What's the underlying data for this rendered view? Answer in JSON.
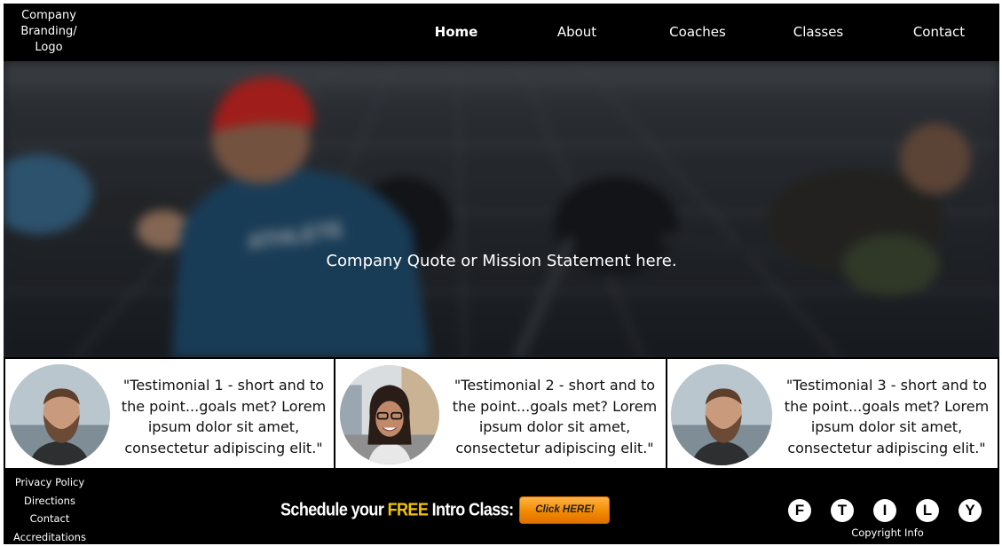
{
  "header": {
    "logo": "Company\nBranding/\nLogo",
    "nav": [
      {
        "label": "Home",
        "active": true
      },
      {
        "label": "About"
      },
      {
        "label": "Coaches"
      },
      {
        "label": "Classes"
      },
      {
        "label": "Contact"
      }
    ]
  },
  "hero": {
    "quote": "Company Quote or Mission Statement here.",
    "shirt_text": "ATHLETE"
  },
  "testimonials": [
    {
      "text": "\"Testimonial 1 - short and to the point...goals met? Lorem ipsum dolor sit amet, consectetur adipiscing elit.\"",
      "avatar": "bearded-man"
    },
    {
      "text": "\"Testimonial 2 - short and to the point...goals met? Lorem ipsum dolor sit amet, consectetur adipiscing elit.\"",
      "avatar": "woman-glasses"
    },
    {
      "text": "\"Testimonial 3 - short and to the point...goals met? Lorem ipsum dolor sit amet, consectetur adipiscing elit.\"",
      "avatar": "bearded-man"
    }
  ],
  "footer": {
    "links": [
      "Privacy Policy",
      "Directions",
      "Contact",
      "Accreditations"
    ],
    "cta_prefix": "Schedule your ",
    "cta_free": "FREE",
    "cta_suffix": " Intro Class:",
    "cta_button": "Click HERE!",
    "socials": [
      "F",
      "T",
      "I",
      "L",
      "Y"
    ],
    "copyright": "Copyright Info"
  },
  "colors": {
    "background": "#000000",
    "free_highlight": "#f5c400",
    "cta_button": "#f28a00"
  }
}
